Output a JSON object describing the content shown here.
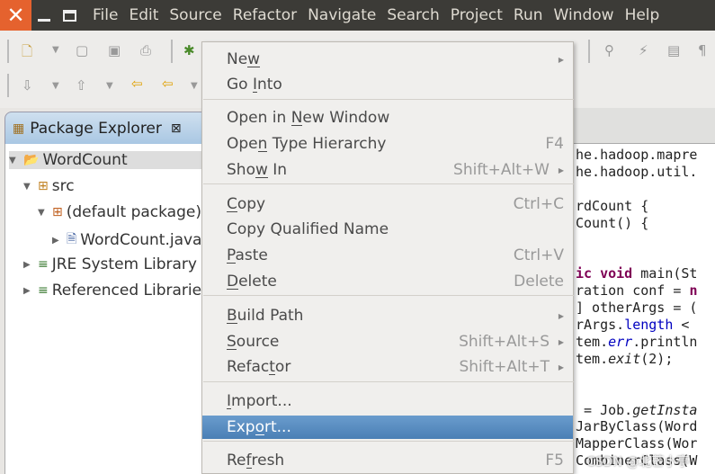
{
  "window": {
    "menus": [
      "File",
      "Edit",
      "Source",
      "Refactor",
      "Navigate",
      "Search",
      "Project",
      "Run",
      "Window",
      "Help"
    ]
  },
  "package_explorer": {
    "title": "Package Explorer",
    "nodes": [
      {
        "label": "WordCount",
        "depth": 0,
        "expanded": true,
        "icon": "java-project-icon"
      },
      {
        "label": "src",
        "depth": 1,
        "expanded": true,
        "icon": "source-folder-icon"
      },
      {
        "label": "(default package)",
        "depth": 2,
        "expanded": true,
        "icon": "package-icon"
      },
      {
        "label": "WordCount.java",
        "depth": 3,
        "expanded": false,
        "icon": "java-file-icon"
      },
      {
        "label": "JRE System Library",
        "depth": 1,
        "expanded": false,
        "icon": "library-icon"
      },
      {
        "label": "Referenced Libraries",
        "depth": 1,
        "expanded": false,
        "icon": "library-icon"
      }
    ]
  },
  "context_menu": {
    "items": [
      {
        "label": "New",
        "mnemonic": 2,
        "submenu": true
      },
      {
        "label": "Go Into",
        "mnemonic": 3
      },
      {
        "sep": true
      },
      {
        "label": "Open in New Window",
        "mnemonic": 8
      },
      {
        "label": "Open Type Hierarchy",
        "mnemonic": 3,
        "accel": "F4"
      },
      {
        "label": "Show In",
        "mnemonic": 3,
        "accel": "Shift+Alt+W",
        "submenu": true
      },
      {
        "sep": true
      },
      {
        "label": "Copy",
        "mnemonic": 0,
        "accel": "Ctrl+C"
      },
      {
        "label": "Copy Qualified Name",
        "mnemonic": -1
      },
      {
        "label": "Paste",
        "mnemonic": 0,
        "accel": "Ctrl+V"
      },
      {
        "label": "Delete",
        "mnemonic": 0,
        "accel": "Delete"
      },
      {
        "sep": true
      },
      {
        "label": "Build Path",
        "mnemonic": 0,
        "submenu": true
      },
      {
        "label": "Source",
        "mnemonic": 0,
        "accel": "Shift+Alt+S",
        "submenu": true
      },
      {
        "label": "Refactor",
        "mnemonic": 5,
        "accel": "Shift+Alt+T",
        "submenu": true
      },
      {
        "sep": true
      },
      {
        "label": "Import...",
        "mnemonic": 0
      },
      {
        "label": "Export...",
        "mnemonic": 3,
        "highlighted": true
      },
      {
        "sep": true
      },
      {
        "label": "Refresh",
        "mnemonic": 2,
        "accel": "F5"
      }
    ]
  },
  "editor": {
    "lines": [
      [
        [
          "he.hadoop.mapre",
          ""
        ]
      ],
      [
        [
          "he.hadoop.util.",
          ""
        ]
      ],
      [],
      [
        [
          "rdCount {",
          ""
        ]
      ],
      [
        [
          "Count() {",
          ""
        ]
      ],
      [],
      [],
      [
        [
          "ic ",
          "kw"
        ],
        [
          "void",
          "kw"
        ],
        [
          " main(St",
          ""
        ]
      ],
      [
        [
          "ration conf = ",
          ""
        ],
        [
          "n",
          "kw"
        ]
      ],
      [
        [
          "] otherArgs = (",
          ""
        ]
      ],
      [
        [
          "rArgs.",
          ""
        ],
        [
          "length",
          "fld"
        ],
        [
          " <",
          ""
        ]
      ],
      [
        [
          "tem.",
          ""
        ],
        [
          "err",
          "fld it"
        ],
        [
          ".println",
          ""
        ]
      ],
      [
        [
          "tem.",
          ""
        ],
        [
          "exit",
          "it"
        ],
        [
          "(2);",
          ""
        ]
      ],
      [],
      [],
      [
        [
          " = Job.",
          ""
        ],
        [
          "getInsta",
          "it"
        ]
      ],
      [
        [
          "JarByClass(Word",
          ""
        ]
      ],
      [
        [
          "MapperClass(Wor",
          ""
        ]
      ],
      [
        [
          "CombinerClass(W",
          ""
        ]
      ]
    ]
  },
  "watermark": "CSDN @北芒小亭"
}
